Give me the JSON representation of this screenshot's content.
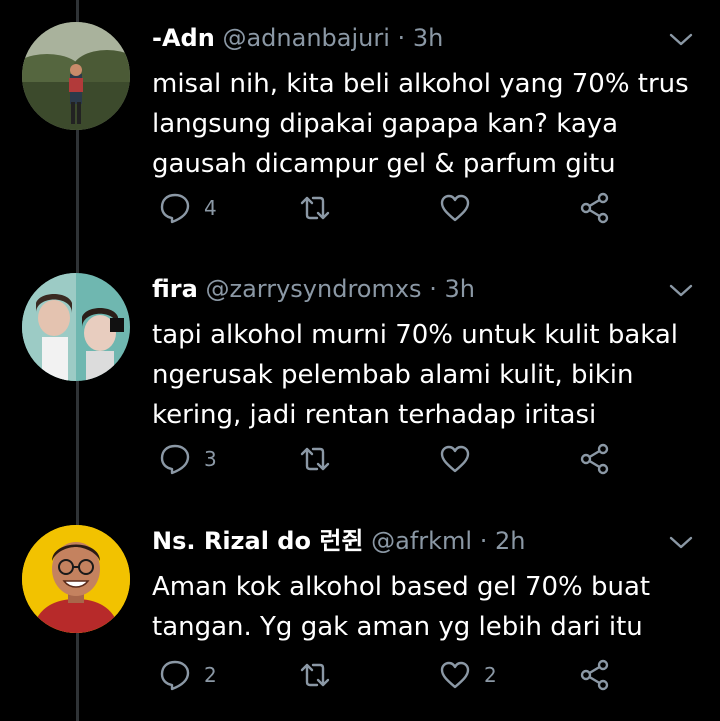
{
  "tweets": [
    {
      "name": "-Adn",
      "handle": "@adnanbajuri",
      "separator": "·",
      "time": "3h",
      "text": "misal nih, kita beli alkohol yang 70% trus langsung dipakai gapapa kan? kaya gausah dicampur gel & parfum gitu",
      "replies": "4",
      "retweets": "",
      "likes": ""
    },
    {
      "name": "fira",
      "handle": "@zarrysyndromxs",
      "separator": "·",
      "time": "3h",
      "text": "tapi alkohol murni 70% untuk kulit bakal ngerusak pelembab alami kulit, bikin kering, jadi rentan terhadap iritasi",
      "replies": "3",
      "retweets": "",
      "likes": ""
    },
    {
      "name": "Ns. Rizal do 런쥔",
      "handle": "@afrkml",
      "separator": "·",
      "time": "2h",
      "text": "Aman kok alkohol based gel 70% buat tangan. Yg gak aman yg lebih dari itu",
      "replies": "2",
      "retweets": "",
      "likes": "2"
    }
  ],
  "colors": {
    "background": "#000000",
    "text": "#ffffff",
    "muted": "#8b98a5",
    "thread_line": "#2f3336"
  },
  "icons": [
    "reply-icon",
    "retweet-icon",
    "like-icon",
    "share-icon",
    "chevron-down-icon"
  ]
}
